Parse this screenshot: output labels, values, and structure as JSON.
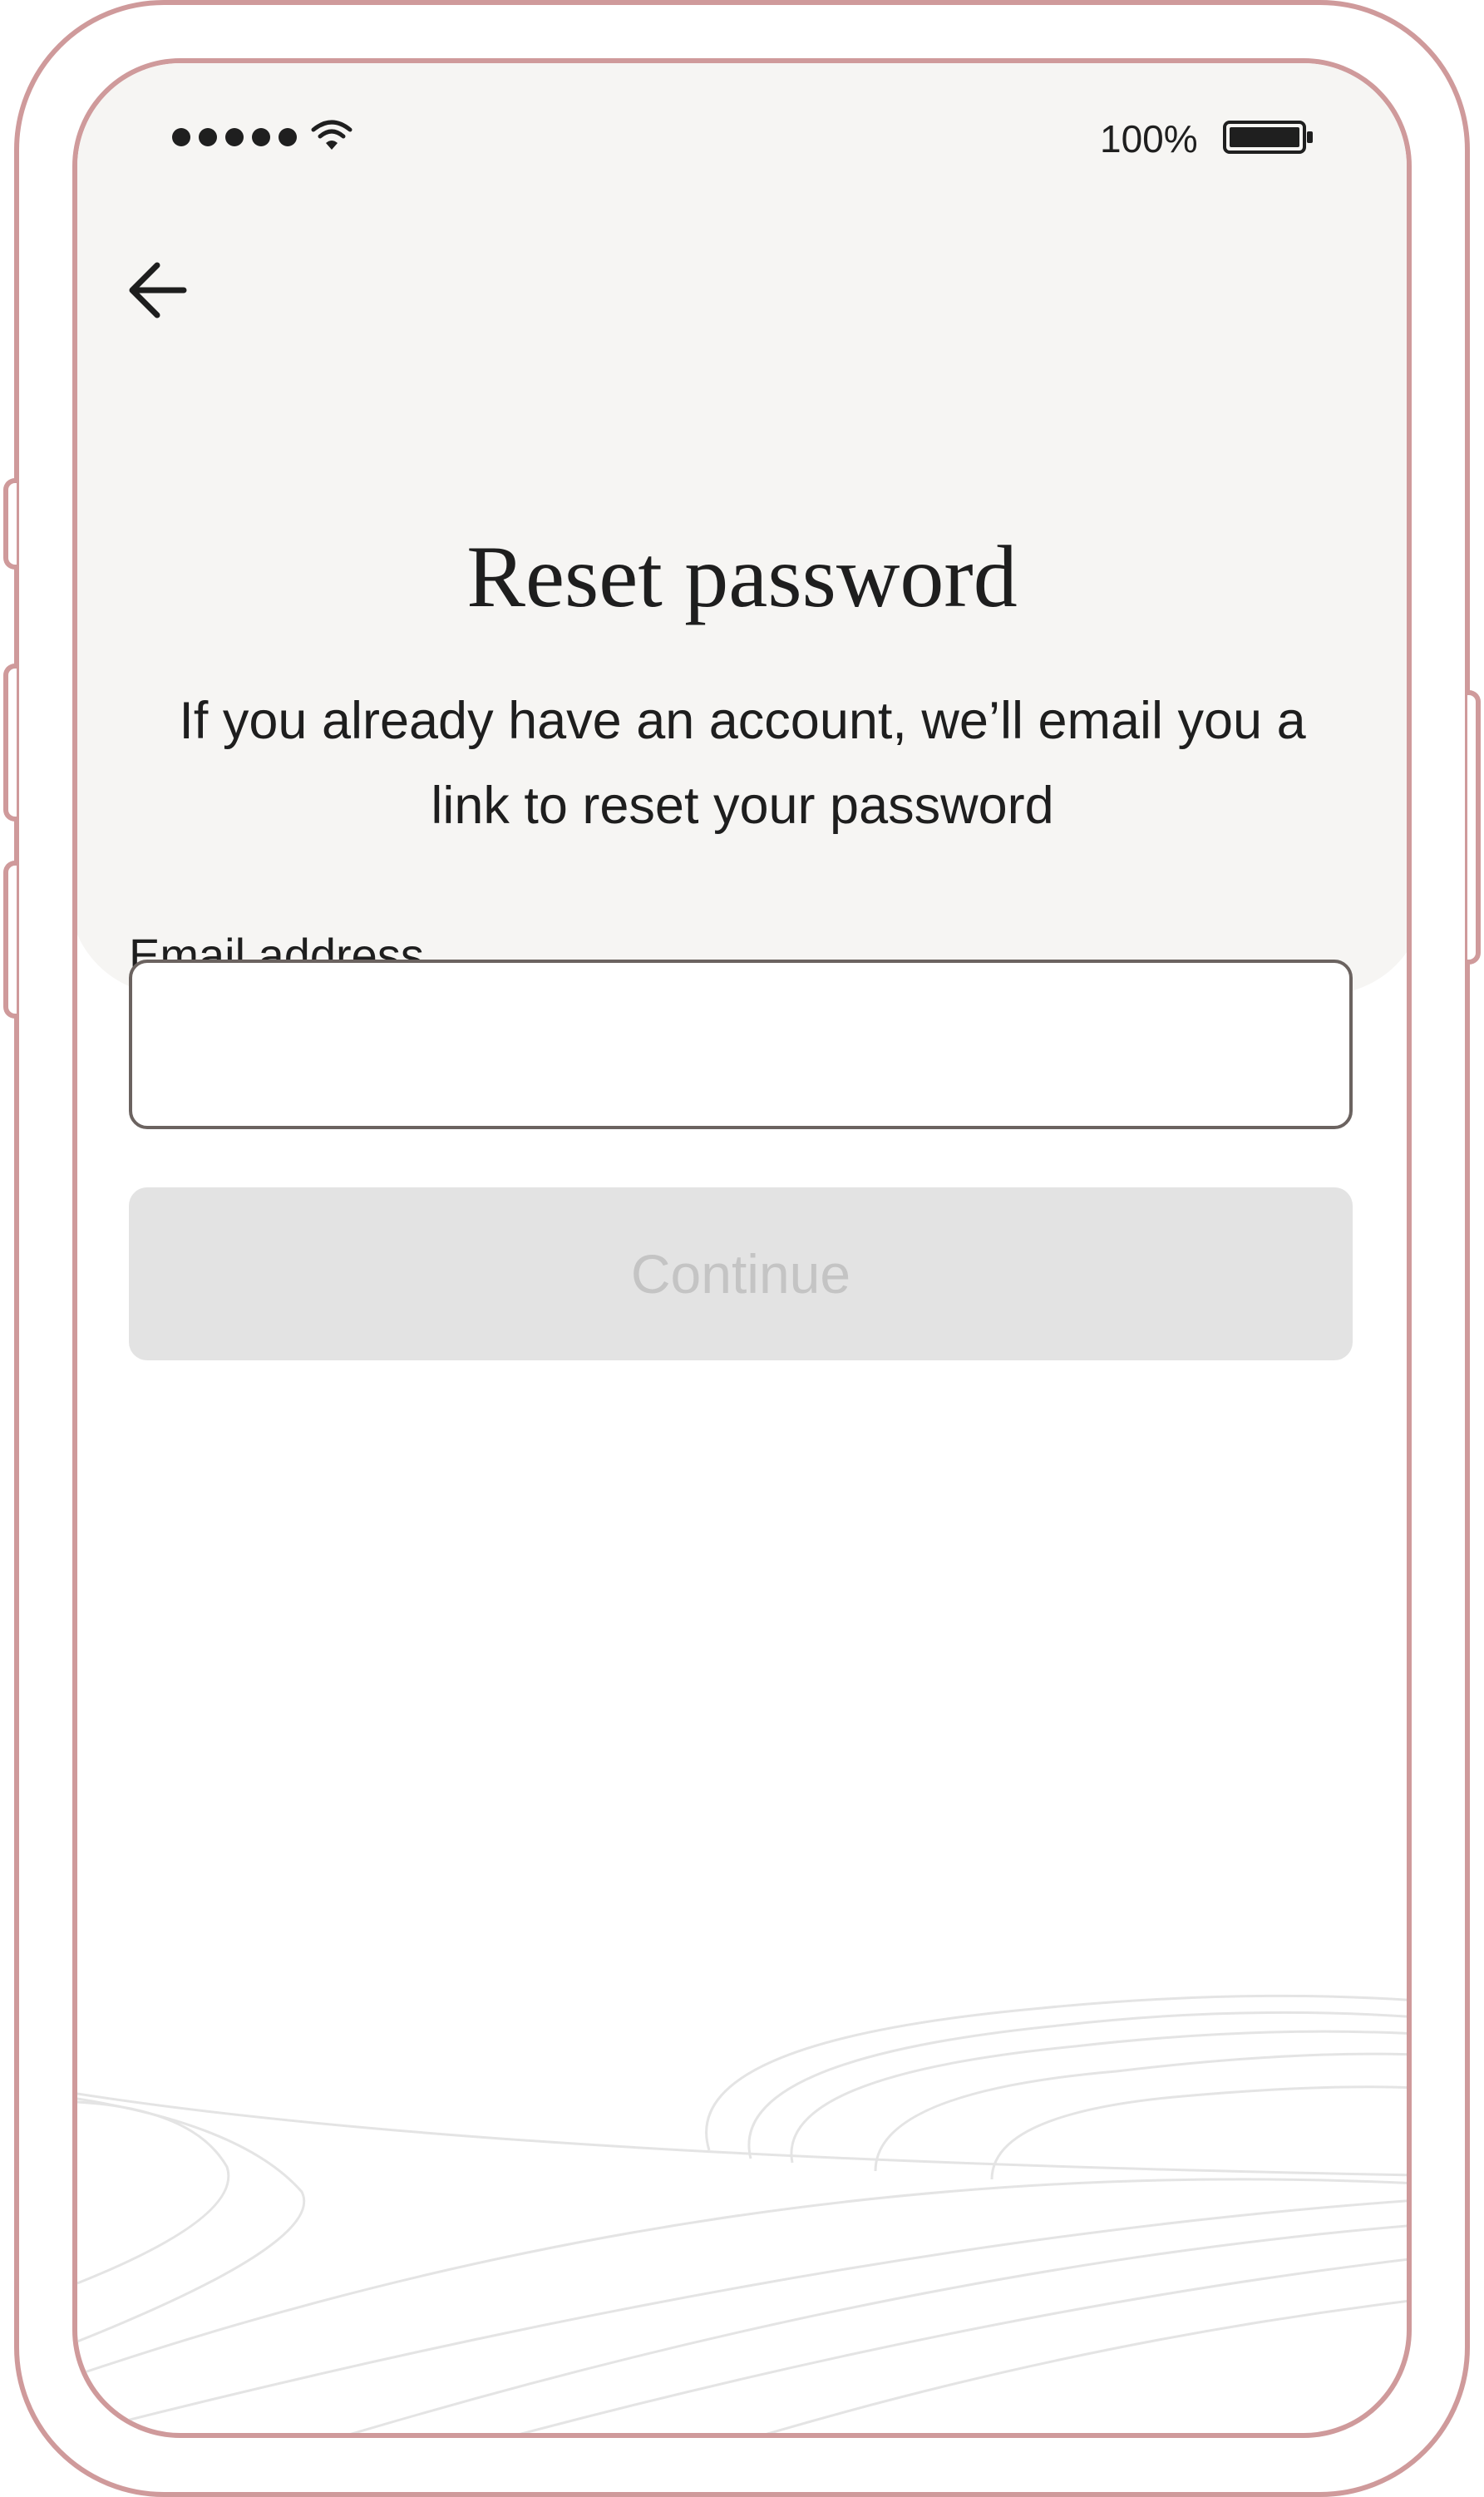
{
  "status_bar": {
    "battery_percent": "100%",
    "signal_icon": "signal-dots-icon",
    "wifi_icon": "wifi-icon",
    "battery_icon": "battery-icon"
  },
  "nav": {
    "back_icon": "arrow-left-icon"
  },
  "page": {
    "title": "Reset password",
    "subtitle": "If you already have an account, we’ll email you a link to reset your password"
  },
  "form": {
    "email_label": "Email address",
    "email_value": "",
    "email_placeholder": "",
    "continue_label": "Continue",
    "continue_enabled": false
  },
  "colors": {
    "device_outline": "#cf9a9b",
    "top_panel_bg": "#f6f5f3",
    "text_primary": "#1e1e1e",
    "button_disabled_bg": "#e3e3e3",
    "button_disabled_text": "#c4c4c4",
    "input_border": "#6b6360"
  }
}
